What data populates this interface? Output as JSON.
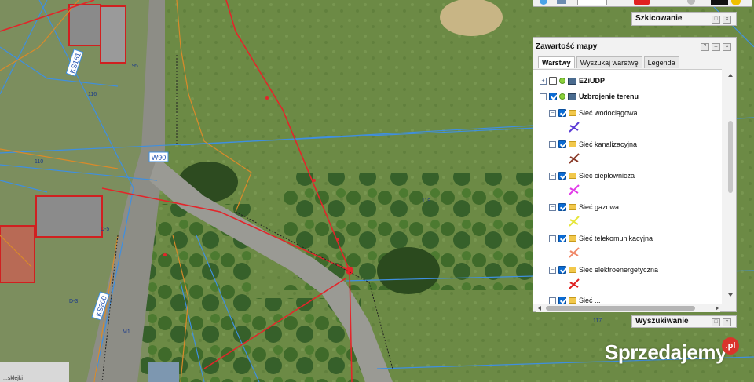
{
  "map": {
    "road_labels": [
      "KS161",
      "W90",
      "KS200"
    ],
    "parcel_labels": [
      "116",
      "110",
      "119",
      "95",
      "117",
      "D-3",
      "D-5",
      "M1"
    ],
    "scale_fragment": "...sklejki"
  },
  "top_toolbar": {
    "items": [
      "youtube-icon",
      "globe-icon",
      "map-icon",
      "layers-icon",
      "settings-icon"
    ]
  },
  "sketching": {
    "title": "Szkicowanie"
  },
  "map_contents": {
    "title": "Zawartość mapy",
    "tabs": [
      {
        "label": "Warstwy",
        "active": true
      },
      {
        "label": "Wyszukaj warstwę",
        "active": false
      },
      {
        "label": "Legenda",
        "active": false
      }
    ],
    "layers": [
      {
        "name": "EZiUDP",
        "checked": false,
        "expander": "+",
        "level": 0,
        "type": "wms"
      },
      {
        "name": "Uzbrojenie terenu",
        "checked": true,
        "expander": "−",
        "level": 0,
        "type": "wms"
      },
      {
        "name": "Sieć wodociągowa",
        "checked": true,
        "expander": "−",
        "level": 1,
        "type": "folder",
        "color": "#5b3bd6"
      },
      {
        "name": "Sieć kanalizacyjna",
        "checked": true,
        "expander": "−",
        "level": 1,
        "type": "folder",
        "color": "#8a3b2a"
      },
      {
        "name": "Sieć ciepłownicza",
        "checked": true,
        "expander": "−",
        "level": 1,
        "type": "folder",
        "color": "#e13be8"
      },
      {
        "name": "Sieć gazowa",
        "checked": true,
        "expander": "−",
        "level": 1,
        "type": "folder",
        "color": "#e6e63a"
      },
      {
        "name": "Sieć telekomunikacyjna",
        "checked": true,
        "expander": "−",
        "level": 1,
        "type": "folder",
        "color": "#f08a6a"
      },
      {
        "name": "Sieć elektroenergetyczna",
        "checked": true,
        "expander": "−",
        "level": 1,
        "type": "folder",
        "color": "#e02020"
      },
      {
        "name": "Sieć ...",
        "checked": true,
        "expander": "−",
        "level": 1,
        "type": "folder",
        "color": "#444444"
      }
    ]
  },
  "search": {
    "title": "Wyszukiwanie"
  },
  "watermark": {
    "text": "Sprzedajemy",
    "suffix": ".pl"
  },
  "colors": {
    "panel_bg": "#f2f2f2",
    "network_blue": "#3f8fe0",
    "network_red": "#e3252a",
    "boundary_orange": "#d98a2a",
    "grass": "#5b7d3c"
  }
}
